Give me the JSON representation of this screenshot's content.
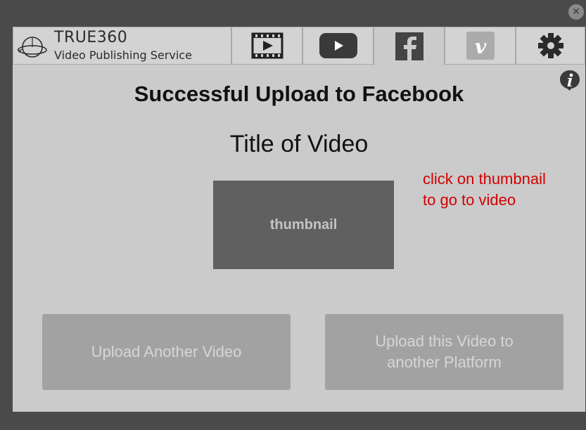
{
  "window": {
    "close_icon": "close-icon"
  },
  "brand": {
    "name_true": "TRUE",
    "name_360": "360",
    "subtitle": "Video Publishing Service"
  },
  "tabs": [
    {
      "name": "video-file",
      "icon": "film-icon"
    },
    {
      "name": "youtube",
      "icon": "youtube-icon"
    },
    {
      "name": "facebook",
      "icon": "facebook-icon",
      "active": true
    },
    {
      "name": "vimeo",
      "icon": "vimeo-icon"
    },
    {
      "name": "settings",
      "icon": "gear-icon"
    }
  ],
  "main": {
    "headline": "Successful Upload to Facebook",
    "video_title": "Title of Video",
    "thumbnail_label": "thumbnail",
    "hint": "click on thumbnail to go to video"
  },
  "actions": {
    "upload_another": "Upload Another Video",
    "upload_platform": "Upload this Video to another Platform"
  },
  "colors": {
    "facebook": "#3b5998",
    "vimeo": "#1ab7ea",
    "hint": "#d10000"
  }
}
